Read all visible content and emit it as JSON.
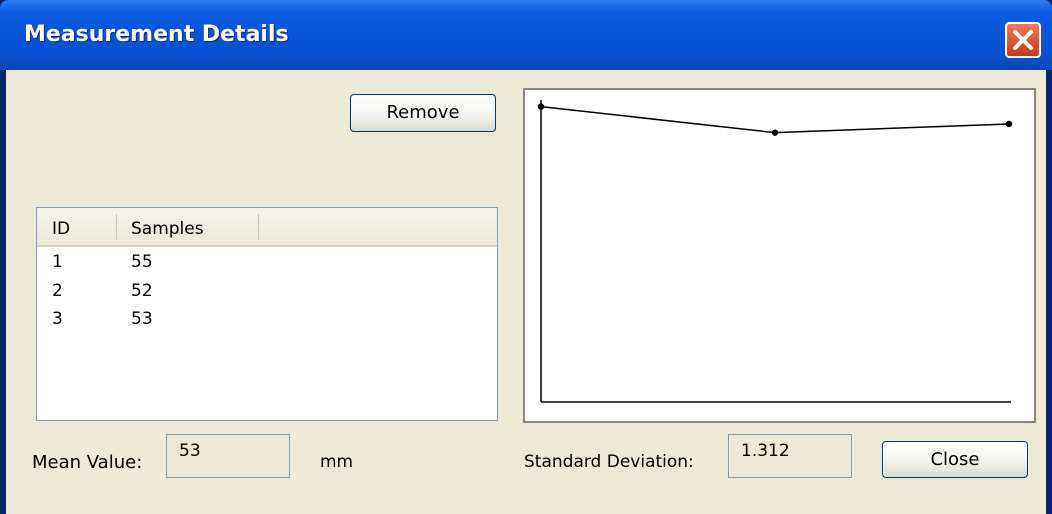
{
  "window": {
    "title": "Measurement Details"
  },
  "buttons": {
    "remove": "Remove",
    "close": "Close"
  },
  "table": {
    "columns": [
      "ID",
      "Samples"
    ],
    "rows": [
      {
        "id": "1",
        "samples": "55"
      },
      {
        "id": "2",
        "samples": "52"
      },
      {
        "id": "3",
        "samples": "53"
      }
    ]
  },
  "mean": {
    "label": "Mean Value:",
    "value": "53",
    "unit": "mm"
  },
  "std_dev": {
    "label": "Standard Deviation:",
    "value": "1.312"
  },
  "chart_data": {
    "type": "line",
    "x": [
      1,
      2,
      3
    ],
    "values": [
      55,
      52,
      53
    ],
    "title": "",
    "xlabel": "",
    "ylabel": "",
    "grid": false
  }
}
